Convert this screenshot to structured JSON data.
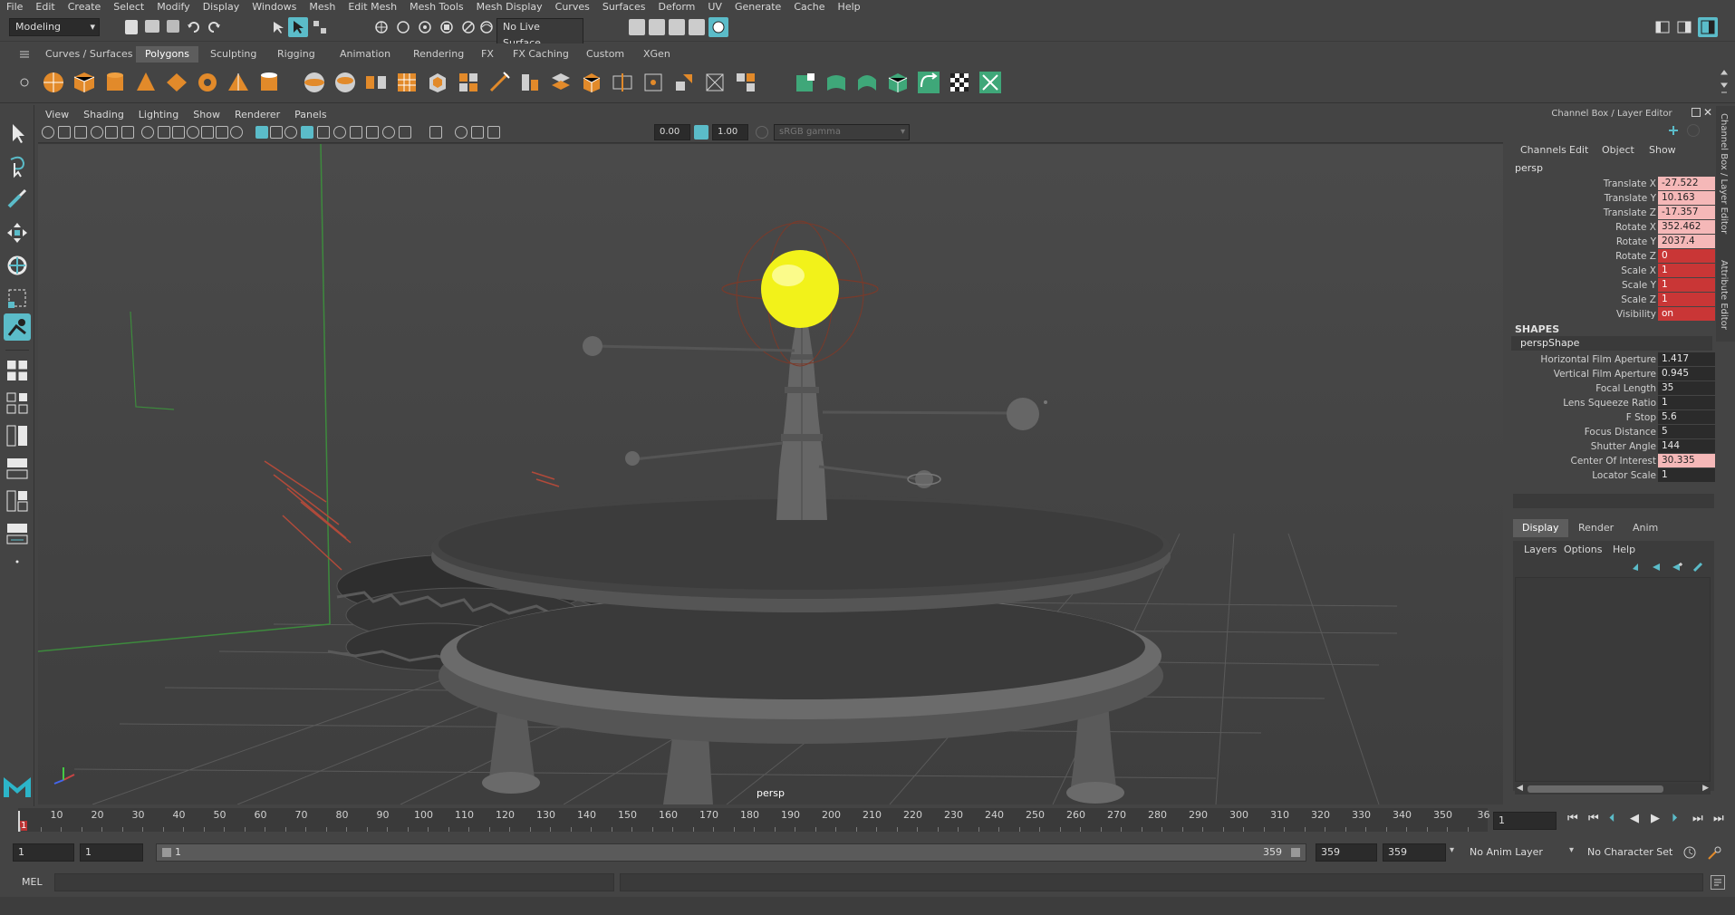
{
  "menubar": [
    "File",
    "Edit",
    "Create",
    "Select",
    "Modify",
    "Display",
    "Windows",
    "Mesh",
    "Edit Mesh",
    "Mesh Tools",
    "Mesh Display",
    "Curves",
    "Surfaces",
    "Deform",
    "UV",
    "Generate",
    "Cache",
    "Help"
  ],
  "statusline": {
    "mode": "Modeling",
    "live_surface": "No Live Surface"
  },
  "shelf_tabs": [
    "Curves / Surfaces",
    "Polygons",
    "Sculpting",
    "Rigging",
    "Animation",
    "Rendering",
    "FX",
    "FX Caching",
    "Custom",
    "XGen"
  ],
  "shelf_active": "Polygons",
  "viewport": {
    "menu": [
      "View",
      "Shading",
      "Lighting",
      "Show",
      "Renderer",
      "Panels"
    ],
    "exposure": "0.00",
    "gamma": "1.00",
    "color_space": "sRGB gamma",
    "camera_label": "persp"
  },
  "channel_box": {
    "title": "Channel Box / Layer Editor",
    "menu": [
      "Channels",
      "Edit",
      "Object",
      "Show"
    ],
    "object": "persp",
    "attributes": [
      {
        "name": "Translate X",
        "value": "-27.522",
        "state": "keyed"
      },
      {
        "name": "Translate Y",
        "value": "10.163",
        "state": "keyed"
      },
      {
        "name": "Translate Z",
        "value": "-17.357",
        "state": "keyed"
      },
      {
        "name": "Rotate X",
        "value": "352.462",
        "state": "keyed"
      },
      {
        "name": "Rotate Y",
        "value": "2037.4",
        "state": "keyed"
      },
      {
        "name": "Rotate Z",
        "value": "0",
        "state": "locked"
      },
      {
        "name": "Scale X",
        "value": "1",
        "state": "locked"
      },
      {
        "name": "Scale Y",
        "value": "1",
        "state": "locked"
      },
      {
        "name": "Scale Z",
        "value": "1",
        "state": "locked"
      },
      {
        "name": "Visibility",
        "value": "on",
        "state": "locked"
      }
    ],
    "shapes_header": "SHAPES",
    "shape_name": "perspShape",
    "shape_attributes": [
      {
        "name": "Horizontal Film Aperture",
        "value": "1.417",
        "state": "normal"
      },
      {
        "name": "Vertical Film Aperture",
        "value": "0.945",
        "state": "normal"
      },
      {
        "name": "Focal Length",
        "value": "35",
        "state": "normal"
      },
      {
        "name": "Lens Squeeze Ratio",
        "value": "1",
        "state": "normal"
      },
      {
        "name": "F Stop",
        "value": "5.6",
        "state": "normal"
      },
      {
        "name": "Focus Distance",
        "value": "5",
        "state": "normal"
      },
      {
        "name": "Shutter Angle",
        "value": "144",
        "state": "normal"
      },
      {
        "name": "Center Of Interest",
        "value": "30.335",
        "state": "keyed"
      },
      {
        "name": "Locator Scale",
        "value": "1",
        "state": "normal"
      }
    ]
  },
  "side_tabs": [
    "Channel Box / Layer Editor",
    "Attribute Editor"
  ],
  "layer_editor": {
    "tabs": [
      "Display",
      "Render",
      "Anim"
    ],
    "active_tab": "Display",
    "menu": [
      "Layers",
      "Options",
      "Help"
    ]
  },
  "timeline": {
    "ticks": [
      "10",
      "20",
      "30",
      "40",
      "50",
      "60",
      "70",
      "80",
      "90",
      "100",
      "110",
      "120",
      "130",
      "140",
      "150",
      "160",
      "170",
      "180",
      "190",
      "200",
      "210",
      "220",
      "230",
      "240",
      "250",
      "260",
      "270",
      "280",
      "290",
      "300",
      "310",
      "320",
      "330",
      "340",
      "350",
      "36"
    ],
    "current_frame_marker": "1",
    "current_frame": "1"
  },
  "range": {
    "start": "1",
    "playback_start": "1",
    "slider_start": "1",
    "slider_end": "359",
    "playback_end": "359",
    "end": "359",
    "anim_layer": "No Anim Layer",
    "character_set": "No Character Set"
  },
  "cmdline": {
    "label": "MEL"
  },
  "colors": {
    "accent_teal": "#5bbcc9",
    "keyed": "#f5b8b8",
    "locked": "#c93636",
    "sun": "#f2f21a"
  }
}
